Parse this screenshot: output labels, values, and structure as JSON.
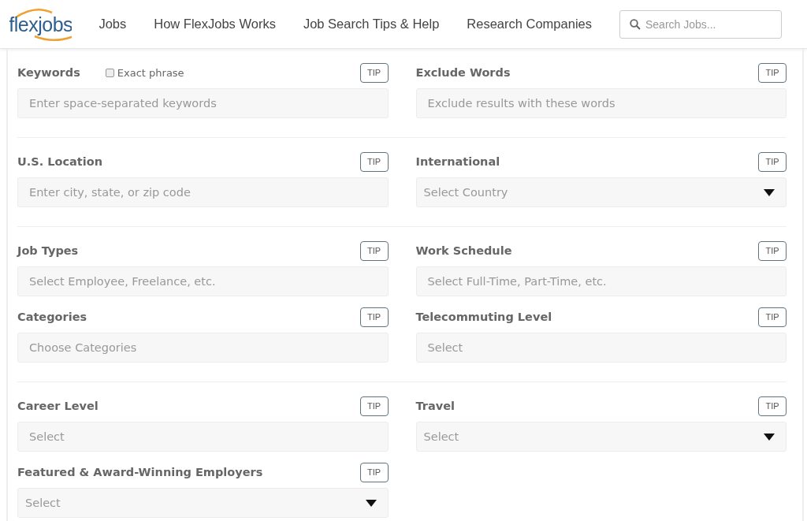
{
  "header": {
    "logo": "flexjobs",
    "nav": [
      "Jobs",
      "How FlexJobs Works",
      "Job Search Tips & Help",
      "Research Companies"
    ],
    "search": {
      "placeholder": "Search Jobs..."
    }
  },
  "sections": [
    {
      "rows": [
        [
          {
            "label": "Keywords",
            "kind": "input",
            "placeholder": "Enter space-separated keywords",
            "tip": "TIP",
            "option": {
              "label": "Exact phrase",
              "checked": false
            }
          },
          {
            "label": "Exclude Words",
            "kind": "input",
            "placeholder": "Exclude results with these words",
            "tip": "TIP"
          }
        ]
      ]
    },
    {
      "rows": [
        [
          {
            "label": "U.S. Location",
            "kind": "input",
            "placeholder": "Enter city, state, or zip code",
            "tip": "TIP"
          },
          {
            "label": "International",
            "kind": "dropdown",
            "placeholder": "Select Country",
            "tip": "TIP"
          }
        ]
      ]
    },
    {
      "rows": [
        [
          {
            "label": "Job Types",
            "kind": "input",
            "placeholder": "Select Employee, Freelance, etc.",
            "tip": "TIP"
          },
          {
            "label": "Work Schedule",
            "kind": "input",
            "placeholder": "Select Full-Time, Part-Time, etc.",
            "tip": "TIP"
          }
        ],
        [
          {
            "label": "Categories",
            "kind": "input",
            "placeholder": "Choose Categories",
            "tip": "TIP"
          },
          {
            "label": "Telecommuting Level",
            "kind": "input",
            "placeholder": "Select",
            "tip": "TIP"
          }
        ]
      ]
    },
    {
      "rows": [
        [
          {
            "label": "Career Level",
            "kind": "input",
            "placeholder": "Select",
            "tip": "TIP"
          },
          {
            "label": "Travel",
            "kind": "dropdown",
            "placeholder": "Select",
            "tip": "TIP"
          }
        ],
        [
          {
            "label": "Featured & Award-Winning Employers",
            "kind": "dropdown",
            "placeholder": "Select",
            "tip": "TIP"
          }
        ]
      ]
    }
  ]
}
